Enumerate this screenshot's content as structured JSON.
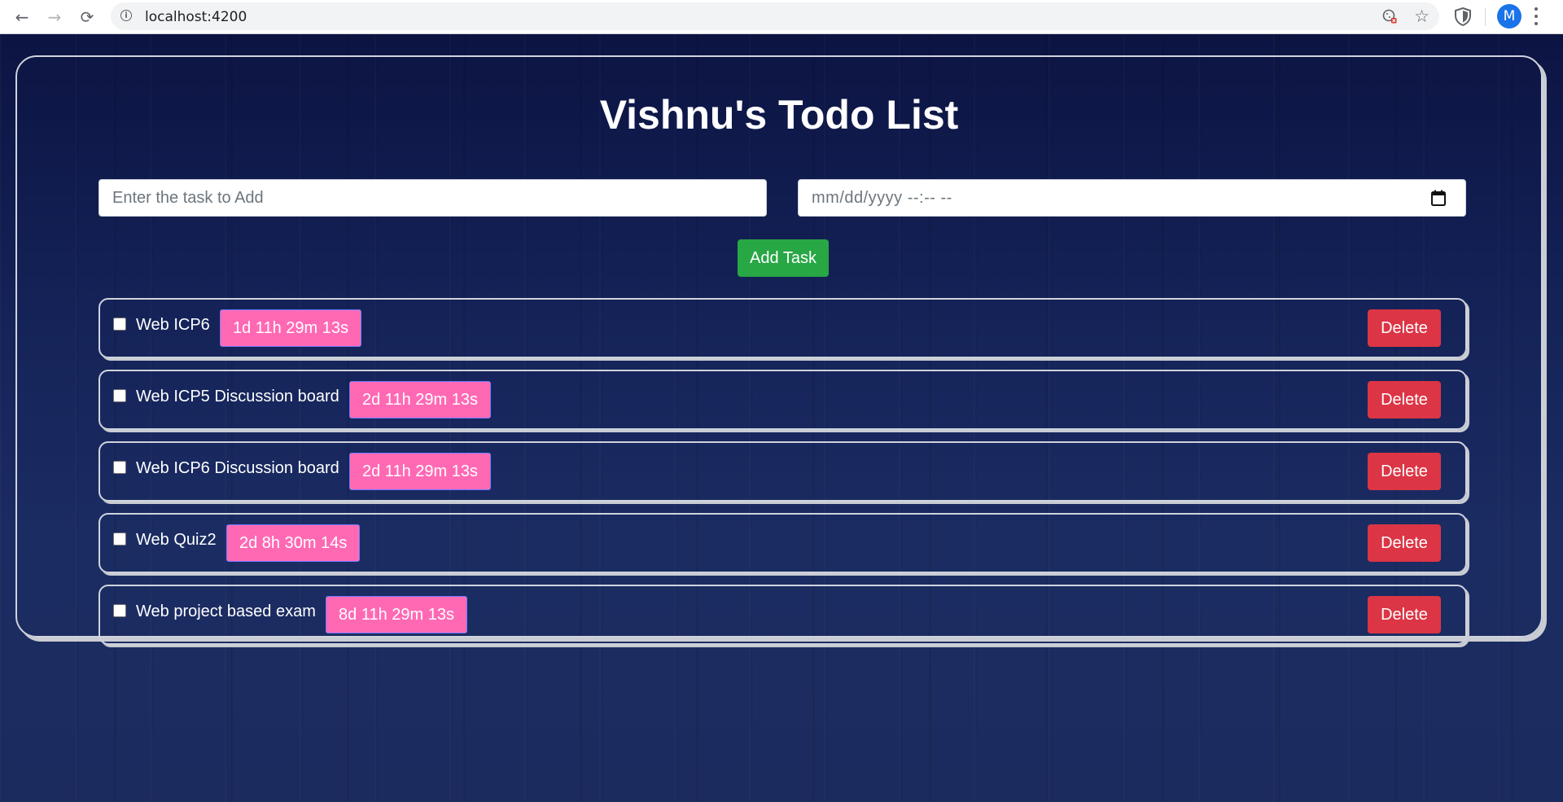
{
  "browser": {
    "url": "localhost:4200",
    "profile_initial": "M",
    "nav_back": "←",
    "nav_forward": "→",
    "nav_reload": "⟳",
    "info_glyph": "i",
    "star_glyph": "☆"
  },
  "app": {
    "title": "Vishnu's Todo List",
    "task_input_placeholder": "Enter the task to Add",
    "date_input_placeholder": "mm/dd/yyyy --:-- --",
    "add_button_label": "Add Task",
    "delete_button_label": "Delete"
  },
  "tasks": [
    {
      "name": "Web ICP6",
      "remaining": "1d 11h 29m 13s",
      "checked": false
    },
    {
      "name": "Web ICP5 Discussion board",
      "remaining": "2d 11h 29m 13s",
      "checked": false
    },
    {
      "name": "Web ICP6 Discussion board",
      "remaining": "2d 11h 29m 13s",
      "checked": false
    },
    {
      "name": "Web Quiz2",
      "remaining": "2d 8h 30m 14s",
      "checked": false
    },
    {
      "name": "Web project based exam",
      "remaining": "8d 11h 29m 13s",
      "checked": false
    }
  ],
  "colors": {
    "add_button": "#28a745",
    "delete_button": "#dc3545",
    "timer_badge": "#ff69b4",
    "background": "#142257"
  }
}
